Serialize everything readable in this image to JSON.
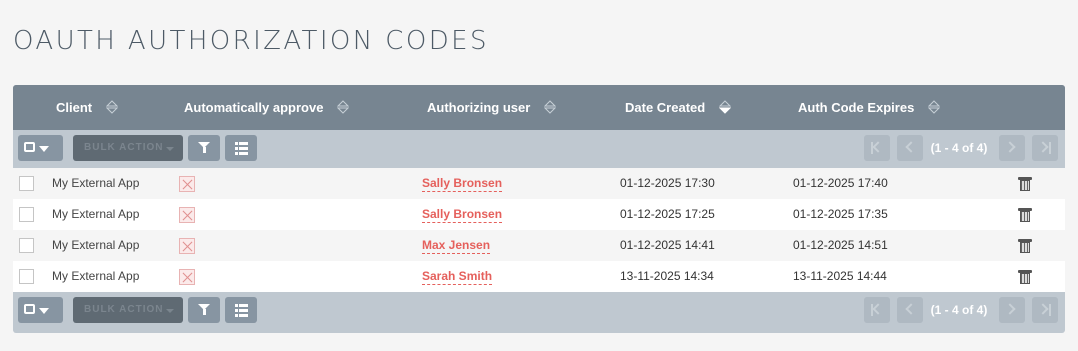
{
  "page": {
    "title": "OAUTH AUTHORIZATION CODES"
  },
  "table": {
    "columns": [
      {
        "label": "Client",
        "sort": "none"
      },
      {
        "label": "Automatically approve",
        "sort": "none"
      },
      {
        "label": "Authorizing user",
        "sort": "none"
      },
      {
        "label": "Date Created",
        "sort": "desc"
      },
      {
        "label": "Auth Code Expires",
        "sort": "none"
      }
    ],
    "toolbar": {
      "bulk_action_label": "BULK ACTION",
      "pagination_text": "(1 - 4 of 4)"
    },
    "rows": [
      {
        "client": "My External App",
        "auto_approve": false,
        "user": "Sally Bronsen",
        "date_created": "01-12-2025 17:30",
        "expires": "01-12-2025 17:40"
      },
      {
        "client": "My External App",
        "auto_approve": false,
        "user": "Sally Bronsen",
        "date_created": "01-12-2025 17:25",
        "expires": "01-12-2025 17:35"
      },
      {
        "client": "My External App",
        "auto_approve": false,
        "user": "Max Jensen",
        "date_created": "01-12-2025 14:41",
        "expires": "01-12-2025 14:51"
      },
      {
        "client": "My External App",
        "auto_approve": false,
        "user": "Sarah Smith",
        "date_created": "13-11-2025 14:34",
        "expires": "13-11-2025 14:44"
      }
    ]
  },
  "colors": {
    "header_bg": "#778591",
    "toolbar_bg": "#bfc8d0",
    "link": "#e5605c"
  },
  "icons": [
    "select-all-icon",
    "filter-icon",
    "column-chooser-icon",
    "first-page-icon",
    "prev-page-icon",
    "next-page-icon",
    "last-page-icon",
    "unchecked-x-icon",
    "trash-icon",
    "sort-icon"
  ]
}
